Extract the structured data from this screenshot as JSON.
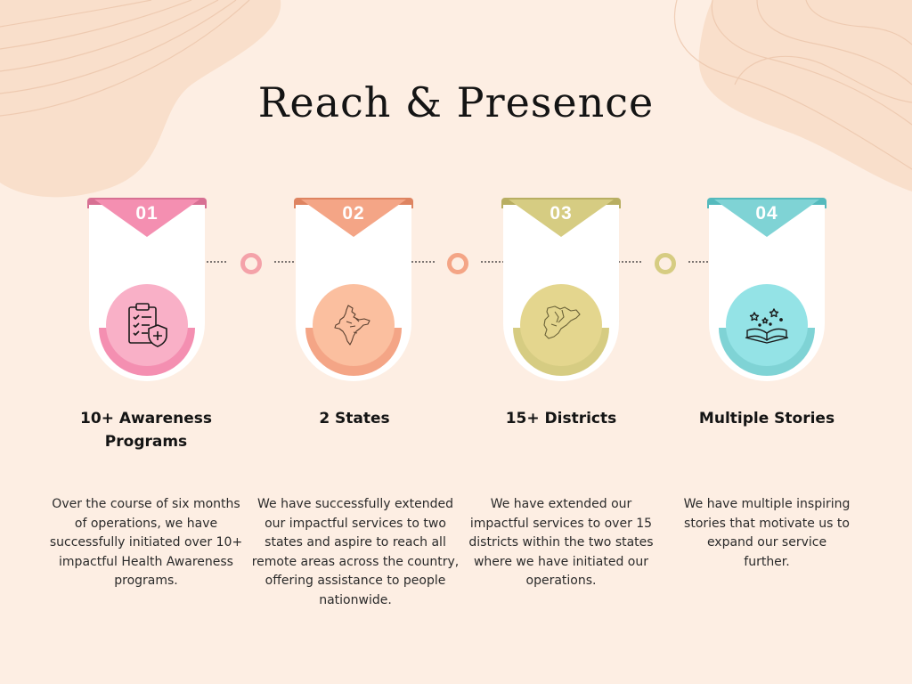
{
  "title": "Reach & Presence",
  "colors": {
    "background": "#fdeee3",
    "step1": "#f48fb1",
    "step1_tab": "#d77093",
    "step2": "#f4a586",
    "step2_tab": "#de8461",
    "step3": "#d6cc82",
    "step3_tab": "#b8ae62",
    "step4": "#7fd3d5",
    "step4_tab": "#55babd"
  },
  "steps": [
    {
      "number": "01",
      "icon": "health-checklist-icon",
      "label_line1": "10+ Awareness",
      "label_line2": "Programs",
      "description": [
        "Over the course of six months",
        "of operations, we have",
        "successfully initiated over 10+",
        "impactful Health Awareness",
        "programs."
      ]
    },
    {
      "number": "02",
      "icon": "india-map-icon",
      "label_line1": "2 States",
      "label_line2": "",
      "description": [
        "We have successfully extended",
        "our impactful services to two",
        "states and aspire to reach all",
        "remote areas across the country,",
        "offering assistance to people",
        "nationwide."
      ]
    },
    {
      "number": "03",
      "icon": "state-map-icon",
      "label_line1": "15+ Districts",
      "label_line2": "",
      "description": [
        "We have extended our",
        "impactful services to over 15",
        "districts within the two states",
        "where we have initiated our",
        "operations."
      ]
    },
    {
      "number": "04",
      "icon": "open-book-stars-icon",
      "label_line1": "Multiple Stories",
      "label_line2": "",
      "description": [
        "We have multiple inspiring",
        "stories that motivate us to",
        "expand our service",
        "further."
      ]
    }
  ]
}
